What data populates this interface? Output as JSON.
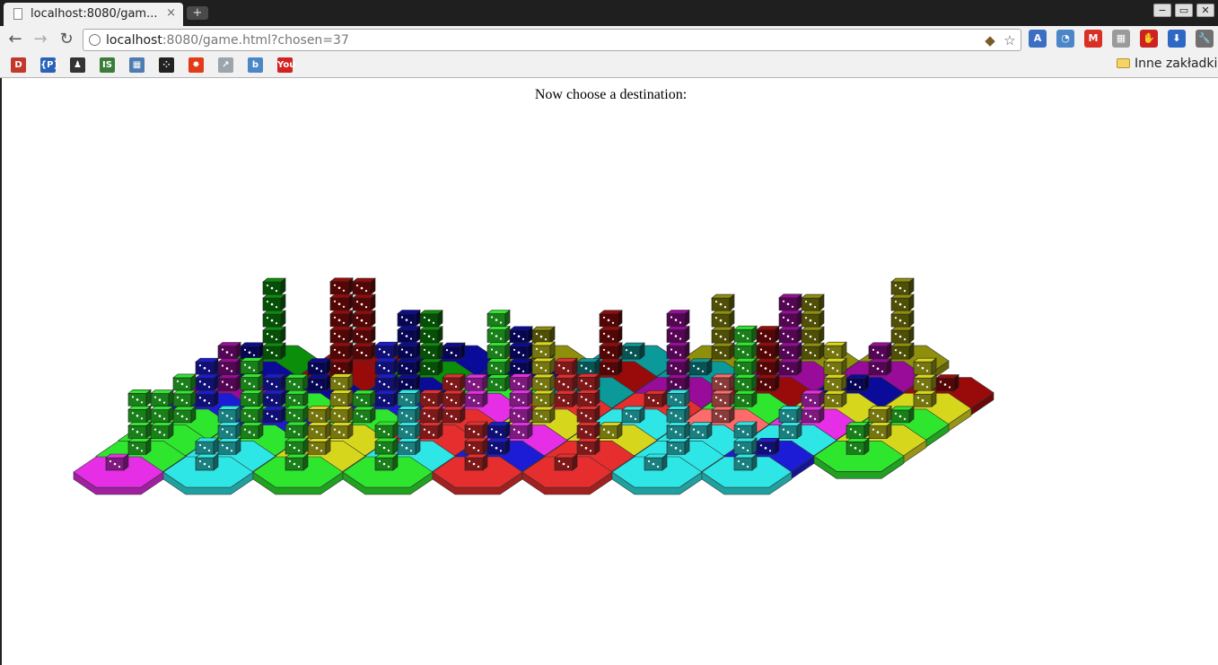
{
  "browser": {
    "tab_title": "localhost:8080/gam...",
    "tab_close": "×",
    "new_tab": "+",
    "window_controls": [
      "−",
      "▭",
      "✕"
    ],
    "address": {
      "host": "localhost",
      "rest": ":8080/game.html?chosen=37"
    },
    "bookmarks_folder": "Inne zakładki",
    "bookmark_icons": [
      {
        "name": "d-bookmark-icon",
        "label": "D",
        "color": "#c0392b"
      },
      {
        "name": "house-bookmark-icon",
        "label": "{P}",
        "color": "#2a62b8"
      },
      {
        "name": "figure-bookmark-icon",
        "label": "♟",
        "color": "#333333"
      },
      {
        "name": "is-bookmark-icon",
        "label": "IS",
        "color": "#3a7d3a"
      },
      {
        "name": "windows-bookmark-icon",
        "label": "▦",
        "color": "#4e7bb0"
      },
      {
        "name": "dots-bookmark-icon",
        "label": "⁘",
        "color": "#222222"
      },
      {
        "name": "burst-bookmark-icon",
        "label": "✸",
        "color": "#e23b16"
      },
      {
        "name": "chart-bookmark-icon",
        "label": "↗",
        "color": "#9aa5ad"
      },
      {
        "name": "b-bookmark-icon",
        "label": "b",
        "color": "#4a87c7"
      },
      {
        "name": "youtube-bookmark-icon",
        "label": "You",
        "color": "#d22222"
      }
    ],
    "extensions": [
      {
        "name": "translate-extension-icon",
        "label": "A",
        "color": "#3c6fc2"
      },
      {
        "name": "rss-extension-icon",
        "label": "◔",
        "color": "#4a86c8"
      },
      {
        "name": "gmail-extension-icon",
        "label": "M",
        "color": "#d93025"
      },
      {
        "name": "grid-extension-icon",
        "label": "▦",
        "color": "#9a9a9a"
      },
      {
        "name": "stop-extension-icon",
        "label": "✋",
        "color": "#cc2222"
      },
      {
        "name": "download-extension-icon",
        "label": "⬇",
        "color": "#2f67c4"
      },
      {
        "name": "wrench-menu-icon",
        "label": "🔧",
        "color": "#707070"
      }
    ]
  },
  "game": {
    "prompt": "Now choose a destination:",
    "colors": {
      "magenta": "#e62ee6",
      "cyan": "#2ee6e6",
      "green": "#2ee62e",
      "red": "#e62e2e",
      "blue": "#1c1cd6",
      "yellow": "#d6d61c",
      "darkgreen": "#0b8f0b",
      "darkred": "#990b0b",
      "darkblue": "#0b0b99",
      "olive": "#8f8f0b",
      "teal": "#0b9999",
      "purple": "#990b99",
      "pink": "#ff6b6b"
    },
    "board": [
      [
        "magenta",
        "cyan",
        "green",
        "green",
        "red",
        "red",
        "cyan",
        "cyan"
      ],
      [
        "green",
        "cyan",
        "yellow",
        "cyan",
        "blue",
        "red",
        "cyan",
        "blue",
        "green"
      ],
      [
        "green",
        "green",
        "yellow",
        "red",
        "magenta",
        "yellow",
        "cyan",
        "cyan",
        "yellow"
      ],
      [
        "green",
        "blue",
        "green",
        "red",
        "yellow",
        "cyan",
        "pink",
        "magenta",
        "green"
      ],
      [
        "blue",
        "green",
        "blue",
        "magenta",
        "red",
        "red",
        "green",
        "yellow",
        "yellow"
      ],
      [
        "purple",
        "darkblue",
        "darkblue",
        "green",
        "teal",
        "purple",
        "darkred",
        "darkblue",
        "darkred"
      ],
      [
        "darkblue",
        "darkred",
        "darkgreen",
        "darkblue",
        "darkred",
        "teal",
        "purple",
        "purple"
      ],
      [
        "darkgreen",
        "darkred",
        "darkblue",
        "olive",
        "teal",
        "olive",
        "olive",
        "olive"
      ]
    ],
    "dice": [
      [
        1,
        2,
        4,
        3,
        3,
        1,
        1,
        3
      ],
      [
        4,
        3,
        3,
        4,
        2,
        5,
        4,
        1,
        2
      ],
      [
        3,
        5,
        4,
        3,
        4,
        1,
        1,
        2,
        2
      ],
      [
        3,
        3,
        2,
        3,
        5,
        1,
        3,
        2,
        1
      ],
      [
        3,
        2,
        4,
        2,
        3,
        1,
        5,
        4,
        3
      ],
      [
        3,
        2,
        5,
        5,
        2,
        5,
        4,
        1,
        1
      ],
      [
        2,
        6,
        4,
        3,
        4,
        1,
        5,
        2
      ],
      [
        5,
        5,
        1,
        2,
        1,
        4,
        4,
        5
      ]
    ]
  }
}
